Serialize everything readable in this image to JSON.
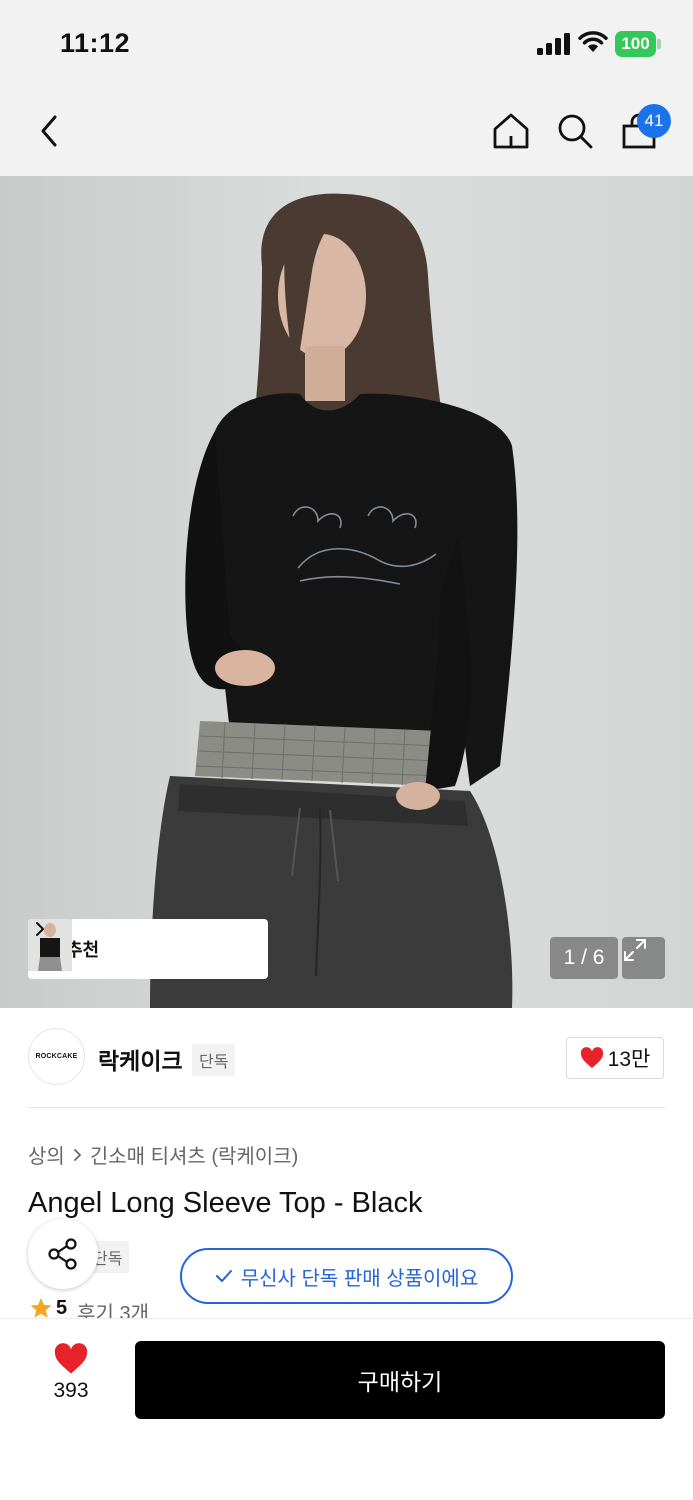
{
  "status_bar": {
    "time": "11:12",
    "battery": "100",
    "battery_color": "#34c759"
  },
  "nav": {
    "cart_badge": "41",
    "icons": [
      "chevron-left-icon",
      "home-icon",
      "search-icon",
      "shopping-bag-icon"
    ]
  },
  "gallery": {
    "ai_recommend_label": "AI 추천",
    "page_counter": "1 / 6"
  },
  "brand": {
    "logo_text": "ROCKCAKE",
    "name": "락케이크",
    "tag": "단독",
    "like_count": "13만"
  },
  "product": {
    "breadcrumb": [
      "상의",
      "긴소매 티셔츠 (락케이크)"
    ],
    "title": "Angel Long Sleeve Top - Black",
    "exclusive_tag": "단독",
    "exclusive_notice": "무신사 단독 판매 상품이에요",
    "rating": "5",
    "review_label": "후기 3개"
  },
  "bottom_bar": {
    "wish_count": "393",
    "buy_label": "구매하기"
  },
  "colors": {
    "accent_blue": "#2464d4",
    "heart_red": "#e8222b",
    "badge_blue": "#1a73e8"
  }
}
